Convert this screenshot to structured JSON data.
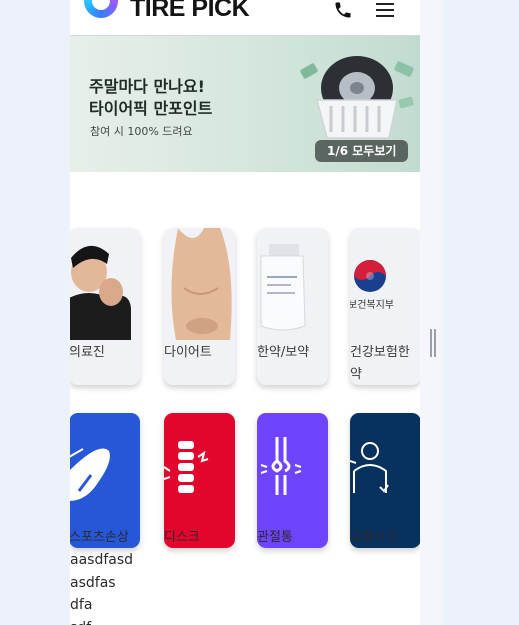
{
  "header": {
    "logo_text": "TIRE PICK"
  },
  "banner": {
    "title": "주말마다 만나요!\n타이어픽 만포인트",
    "subtitle": "참여 시 100% 드려요",
    "counter": "1/6 모두보기"
  },
  "categories_row1": [
    {
      "label": "의료진",
      "icon": "doctor-photo"
    },
    {
      "label": "다이어트",
      "icon": "body-photo"
    },
    {
      "label": "한약/보약",
      "icon": "pouch-photo"
    },
    {
      "label": "건강보험한약",
      "icon": "ministry-logo",
      "logo_caption": "보건복지부"
    }
  ],
  "categories_row2": [
    {
      "label": "스포츠손상",
      "icon": "injured-knee-icon",
      "color": "#2657d6"
    },
    {
      "label": "디스크",
      "icon": "spine-icon",
      "color": "#e3062c"
    },
    {
      "label": "관절통",
      "icon": "joint-icon",
      "color": "#6f44ff"
    },
    {
      "label": "교통사고",
      "icon": "body-pain-icon",
      "color": "#07325f"
    }
  ],
  "overflow_text": "aasdfasd\nasdfas\ndfa\nsdf"
}
